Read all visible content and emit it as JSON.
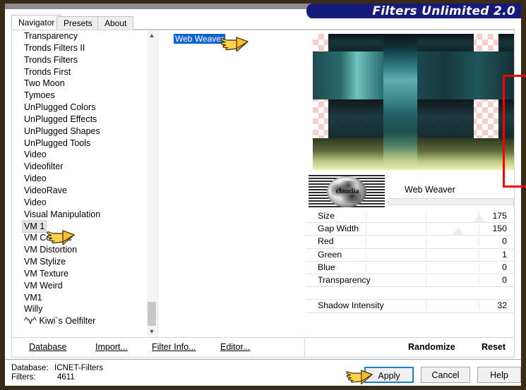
{
  "window": {
    "title": "Filters Unlimited 2.0"
  },
  "tabs": [
    {
      "label": "Navigator",
      "active": true
    },
    {
      "label": "Presets",
      "active": false
    },
    {
      "label": "About",
      "active": false
    }
  ],
  "filter_list": {
    "items": [
      {
        "label": "Transparency"
      },
      {
        "label": "Tronds Filters II"
      },
      {
        "label": "Tronds Filters"
      },
      {
        "label": "Tronds First"
      },
      {
        "label": "Two Moon"
      },
      {
        "label": "Tymoes"
      },
      {
        "label": "UnPlugged Colors"
      },
      {
        "label": "UnPlugged Effects"
      },
      {
        "label": "UnPlugged Shapes"
      },
      {
        "label": "UnPlugged Tools"
      },
      {
        "label": "Video"
      },
      {
        "label": "Videofilter"
      },
      {
        "label": "Video"
      },
      {
        "label": "VideoRave"
      },
      {
        "label": "Video"
      },
      {
        "label": "Visual Manipulation"
      },
      {
        "label": "VM 1",
        "selected": true
      },
      {
        "label": "VM Colorize"
      },
      {
        "label": "VM Distortion"
      },
      {
        "label": "VM Stylize"
      },
      {
        "label": "VM Texture"
      },
      {
        "label": "VM Weird"
      },
      {
        "label": "VM1"
      },
      {
        "label": "Willy"
      },
      {
        "label": "^v^ Kiwi`s Oelfilter"
      }
    ],
    "scroll_up_icon": "chevron-up-icon",
    "scroll_down_icon": "chevron-down-icon"
  },
  "sub_list": {
    "selected_item": "Web Weaver"
  },
  "filter_panel": {
    "name": "Web Weaver",
    "logo_text": "claudia",
    "parameters": [
      {
        "name": "Size",
        "value": "175"
      },
      {
        "name": "Gap Width",
        "value": "150"
      },
      {
        "name": "Red",
        "value": "0"
      },
      {
        "name": "Green",
        "value": "1"
      },
      {
        "name": "Blue",
        "value": "0"
      },
      {
        "name": "Transparency",
        "value": "0"
      },
      {
        "name": "",
        "value": ""
      },
      {
        "name": "Shadow Intensity",
        "value": "32"
      }
    ],
    "highlight_color": "#ff0000"
  },
  "link_bar": {
    "database": "Database",
    "import": "Import...",
    "filter_info": "Filter Info...",
    "editor": "Editor...",
    "randomize": "Randomize",
    "reset": "Reset"
  },
  "status": {
    "database_label": "Database:",
    "database_value": "ICNET-Filters",
    "filters_label": "Filters:",
    "filters_value": "4611"
  },
  "buttons": {
    "apply": "Apply",
    "cancel": "Cancel",
    "help": "Help"
  },
  "colors": {
    "banner_bg": "#151b7a",
    "selection_blue": "#1063d6",
    "focus_blue": "#1b7fd4",
    "highlight_red": "#ff0000"
  }
}
